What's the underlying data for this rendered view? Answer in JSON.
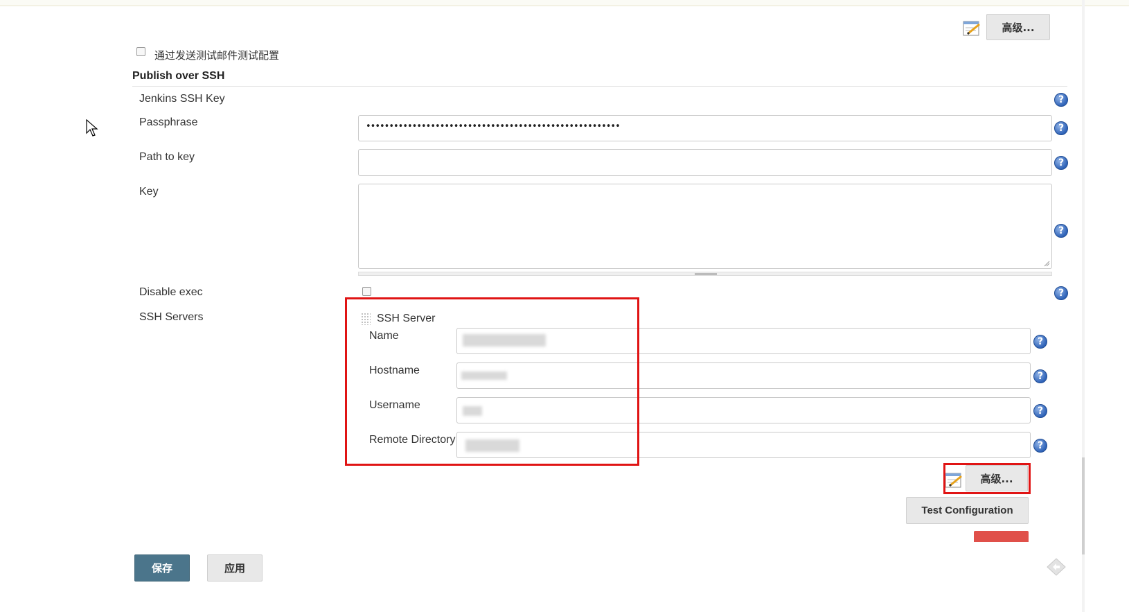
{
  "top_advanced_label": "高级...",
  "test_email_checkbox_label": "通过发送测试邮件测试配置",
  "section_title": "Publish over SSH",
  "fields": {
    "jenkins_ssh_key": "Jenkins SSH Key",
    "passphrase": "Passphrase",
    "passphrase_value": "•••••••••••••••••••••••••••••••••••••••••••••••••••••••",
    "path_to_key": "Path to key",
    "key": "Key",
    "disable_exec": "Disable exec",
    "ssh_servers": "SSH Servers"
  },
  "ssh_server": {
    "header": "SSH Server",
    "name_label": "Name",
    "hostname_label": "Hostname",
    "username_label": "Username",
    "remote_directory_label": "Remote Directory",
    "advanced_label": "高级...",
    "test_configuration_label": "Test Configuration"
  },
  "footer": {
    "save_label": "保存",
    "apply_label": "应用"
  },
  "colors": {
    "highlight_red": "#e01414",
    "save_button": "#4b758b",
    "delete_button": "#e0504a"
  }
}
